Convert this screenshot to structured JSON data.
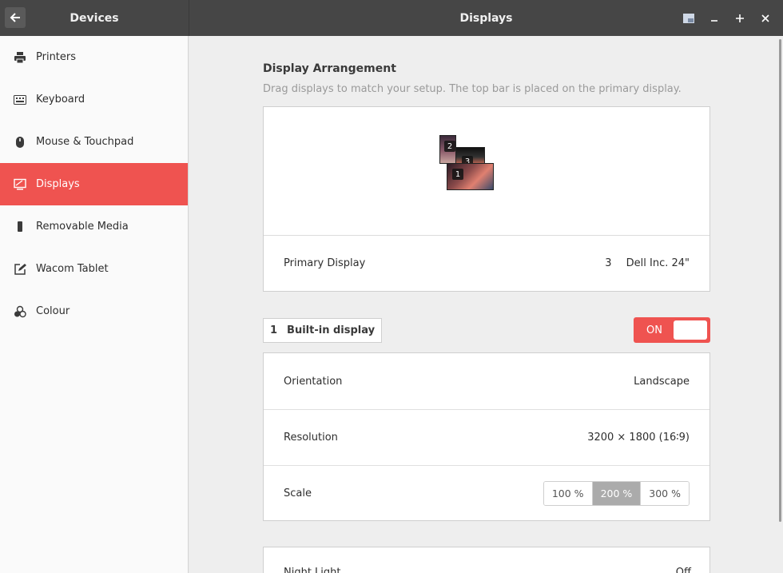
{
  "header": {
    "left_title": "Devices",
    "right_title": "Displays",
    "back_icon": "arrow-left-icon",
    "window_controls": [
      "screenshot-icon",
      "minimize-icon",
      "maximize-icon",
      "close-icon"
    ]
  },
  "sidebar": {
    "items": [
      {
        "label": "Printers",
        "icon": "printer-icon",
        "active": false
      },
      {
        "label": "Keyboard",
        "icon": "keyboard-icon",
        "active": false
      },
      {
        "label": "Mouse & Touchpad",
        "icon": "mouse-icon",
        "active": false
      },
      {
        "label": "Displays",
        "icon": "display-icon",
        "active": true
      },
      {
        "label": "Removable Media",
        "icon": "usb-drive-icon",
        "active": false
      },
      {
        "label": "Wacom Tablet",
        "icon": "tablet-pen-icon",
        "active": false
      },
      {
        "label": "Colour",
        "icon": "colour-icon",
        "active": false
      }
    ]
  },
  "arrangement": {
    "title": "Display Arrangement",
    "subtitle": "Drag displays to match your setup. The top bar is placed on the primary display.",
    "monitors": [
      "1",
      "2",
      "3"
    ],
    "primary_label": "Primary Display",
    "primary_number": "3",
    "primary_name": "Dell Inc. 24\""
  },
  "display": {
    "number": "1",
    "name": "Built-in display",
    "toggle_label": "ON",
    "enabled": true,
    "orientation_label": "Orientation",
    "orientation_value": "Landscape",
    "resolution_label": "Resolution",
    "resolution_value": "3200 × 1800 (16∶9)",
    "scale_label": "Scale",
    "scale_options": [
      "100 %",
      "200 %",
      "300 %"
    ],
    "scale_selected": "200 %"
  },
  "night_light": {
    "label": "Night Light",
    "value": "Off"
  },
  "colors": {
    "accent": "#ef5350",
    "headerbar": "#464646"
  }
}
